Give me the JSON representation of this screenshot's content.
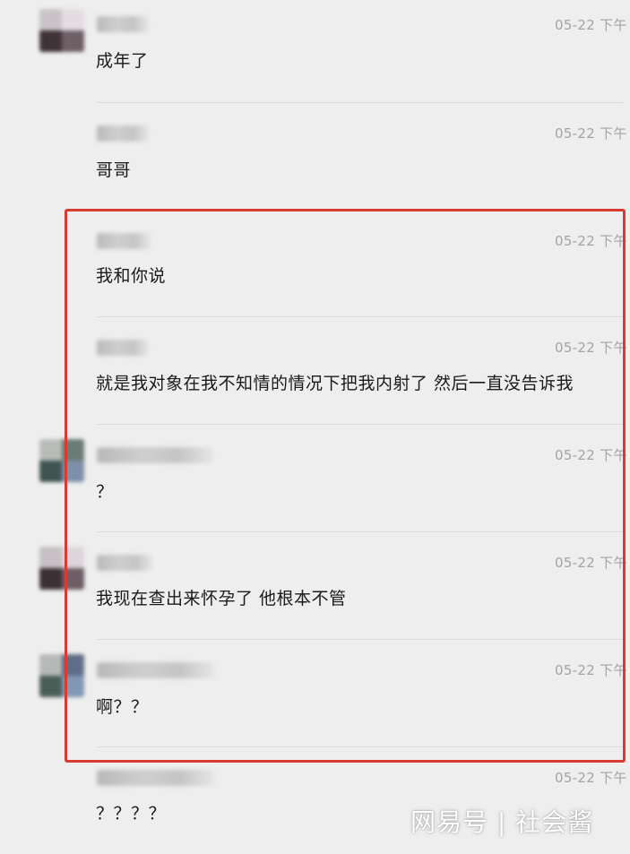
{
  "messages": [
    {
      "time": "05-22 下午",
      "text": "成年了"
    },
    {
      "time": "05-22 下午",
      "text": "哥哥"
    },
    {
      "time": "05-22 下午",
      "text": "我和你说"
    },
    {
      "time": "05-22 下午",
      "text": "就是我对象在我不知情的情况下把我内射了 然后一直没告诉我"
    },
    {
      "time": "05-22 下午",
      "text": "？"
    },
    {
      "time": "05-22 下午",
      "text": "我现在查出来怀孕了 他根本不管"
    },
    {
      "time": "05-22 下午",
      "text": "啊？？"
    },
    {
      "time": "05-22 下午",
      "text": "？？？？"
    }
  ],
  "watermark": "网易号 | 社会酱",
  "colors": {
    "highlight_border": "#d93a32",
    "background": "#eeeeee",
    "time_text": "#a3a3a3"
  }
}
